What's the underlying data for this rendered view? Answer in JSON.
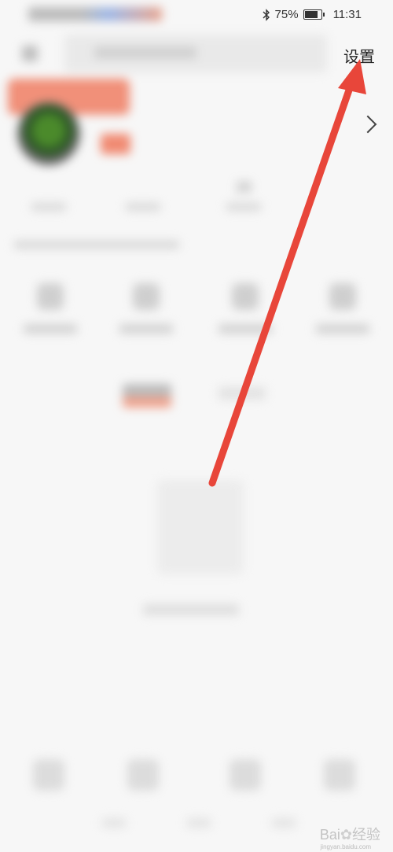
{
  "status_bar": {
    "battery_percent_text": "75%",
    "battery_level": 0.75,
    "time": "11:31",
    "icons": [
      "bluetooth-icon",
      "battery-icon"
    ]
  },
  "header": {
    "settings_label": "设置"
  },
  "profile": {
    "stats": [
      {
        "value": "20"
      }
    ]
  },
  "annotation": {
    "arrow_color": "#e8463a"
  },
  "watermark": {
    "brand": "Bai",
    "brand_suffix": "经验",
    "url": "jingyan.baidu.com"
  }
}
